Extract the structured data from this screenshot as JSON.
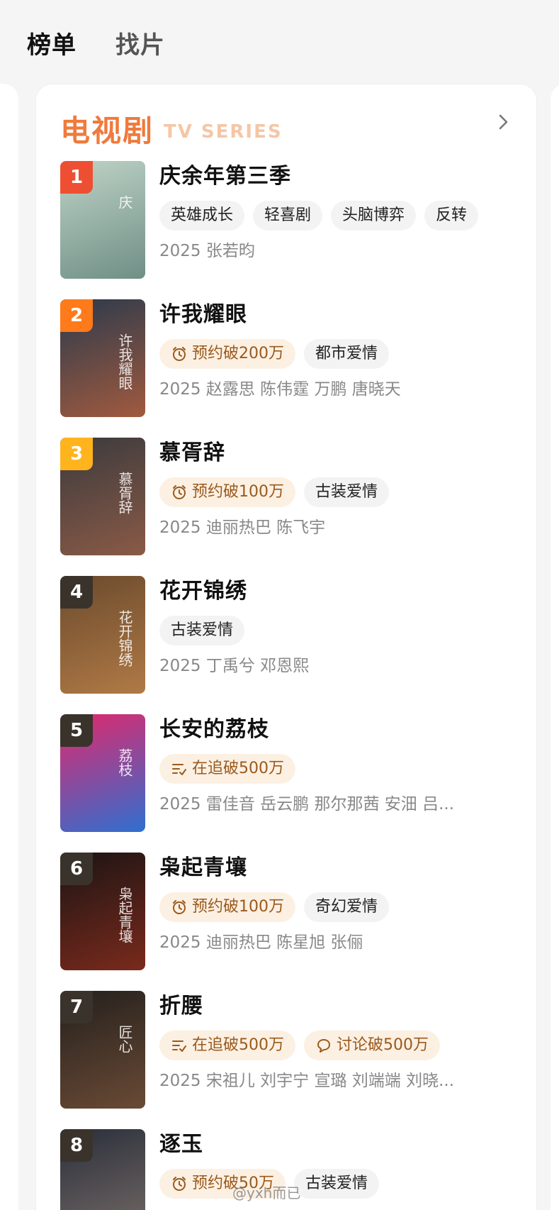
{
  "nav": {
    "tabs": [
      "榜单",
      "找片"
    ]
  },
  "section": {
    "title": "电视剧",
    "subtitle": "TV SERIES"
  },
  "rank_colors": {
    "1": "#ee4f33",
    "2": "#ff7a1a",
    "3": "#ffb41e",
    "other": "#3a332c"
  },
  "items": [
    {
      "rank": "1",
      "title": "庆余年第三季",
      "tags": [
        {
          "icon": "",
          "label": "英雄成长",
          "hot": false
        },
        {
          "icon": "",
          "label": "轻喜剧",
          "hot": false
        },
        {
          "icon": "",
          "label": "头脑博弈",
          "hot": false
        },
        {
          "icon": "",
          "label": "反转",
          "hot": false
        }
      ],
      "meta": "2025 张若昀"
    },
    {
      "rank": "2",
      "title": "许我耀眼",
      "tags": [
        {
          "icon": "alarm-clock-icon",
          "label": "预约破200万",
          "hot": true
        },
        {
          "icon": "",
          "label": "都市爱情",
          "hot": false
        }
      ],
      "meta": "2025 赵露思 陈伟霆 万鹏 唐晓天"
    },
    {
      "rank": "3",
      "title": "慕胥辞",
      "tags": [
        {
          "icon": "alarm-clock-icon",
          "label": "预约破100万",
          "hot": true
        },
        {
          "icon": "",
          "label": "古装爱情",
          "hot": false
        }
      ],
      "meta": "2025 迪丽热巴 陈飞宇"
    },
    {
      "rank": "4",
      "title": "花开锦绣",
      "tags": [
        {
          "icon": "",
          "label": "古装爱情",
          "hot": false
        }
      ],
      "meta": "2025 丁禹兮 邓恩熙"
    },
    {
      "rank": "5",
      "title": "长安的荔枝",
      "tags": [
        {
          "icon": "follow-list-icon",
          "label": "在追破500万",
          "hot": true
        }
      ],
      "meta": "2025 雷佳音 岳云鹏 那尔那茜 安沺 吕..."
    },
    {
      "rank": "6",
      "title": "枭起青壤",
      "tags": [
        {
          "icon": "alarm-clock-icon",
          "label": "预约破100万",
          "hot": true
        },
        {
          "icon": "",
          "label": "奇幻爱情",
          "hot": false
        }
      ],
      "meta": "2025 迪丽热巴 陈星旭 张俪"
    },
    {
      "rank": "7",
      "title": "折腰",
      "tags": [
        {
          "icon": "follow-list-icon",
          "label": "在追破500万",
          "hot": true
        },
        {
          "icon": "chat-bubble-icon",
          "label": "讨论破500万",
          "hot": true
        }
      ],
      "meta": "2025 宋祖儿 刘宇宁 宣璐 刘端端 刘晓..."
    },
    {
      "rank": "8",
      "title": "逐玉",
      "tags": [
        {
          "icon": "alarm-clock-icon",
          "label": "预约破50万",
          "hot": true
        },
        {
          "icon": "",
          "label": "古装爱情",
          "hot": false
        }
      ],
      "meta": ""
    }
  ],
  "posters": [
    {
      "colors": [
        "#bfd3c6",
        "#6f8f86"
      ],
      "text": "庆"
    },
    {
      "colors": [
        "#2b3a4c",
        "#a15a3e"
      ],
      "text": "许我耀眼"
    },
    {
      "colors": [
        "#3b3a3d",
        "#8a5a46"
      ],
      "text": "慕胥辞"
    },
    {
      "colors": [
        "#6b4a2d",
        "#b07a46"
      ],
      "text": "花开锦绣"
    },
    {
      "colors": [
        "#e2286c",
        "#2f6fd0"
      ],
      "text": "荔枝"
    },
    {
      "colors": [
        "#1c1414",
        "#7a2a1c"
      ],
      "text": "枭起青壤"
    },
    {
      "colors": [
        "#24201d",
        "#6a4a35"
      ],
      "text": "匠心"
    },
    {
      "colors": [
        "#2a2f3a",
        "#7a6e6a"
      ],
      "text": ""
    }
  ],
  "watermark": "@yxh而已"
}
